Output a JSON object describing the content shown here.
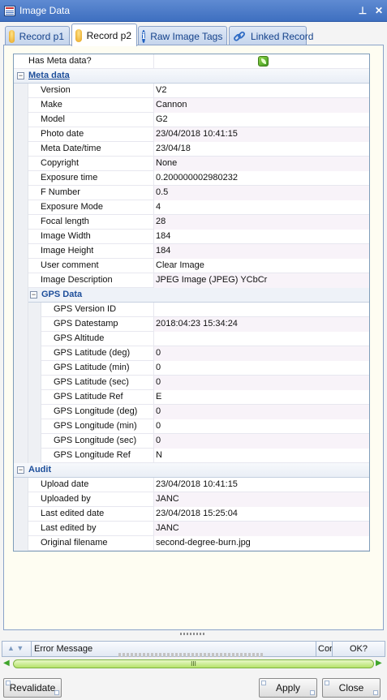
{
  "window": {
    "title": "Image Data"
  },
  "tabs": [
    {
      "label": "Record p1",
      "icon": "database-icon"
    },
    {
      "label": "Record p2",
      "icon": "database-icon"
    },
    {
      "label": "Raw Image Tags",
      "icon": "info-icon"
    },
    {
      "label": "Linked Record",
      "icon": "link-icon"
    }
  ],
  "top_row": {
    "label": "Has Meta data?",
    "value_icon": "leaf-icon"
  },
  "meta": {
    "title": "Meta data",
    "rows": [
      {
        "label": "Version",
        "value": "V2"
      },
      {
        "label": "Make",
        "value": "Cannon"
      },
      {
        "label": "Model",
        "value": "G2"
      },
      {
        "label": "Photo date",
        "value": "23/04/2018 10:41:15"
      },
      {
        "label": "Meta Date/time",
        "value": "23/04/18"
      },
      {
        "label": "Copyright",
        "value": "None"
      },
      {
        "label": "Exposure time",
        "value": "0.200000002980232"
      },
      {
        "label": "F Number",
        "value": "0.5"
      },
      {
        "label": "Exposure Mode",
        "value": "4"
      },
      {
        "label": "Focal length",
        "value": "28"
      },
      {
        "label": "Image Width",
        "value": "184"
      },
      {
        "label": "Image Height",
        "value": "184"
      },
      {
        "label": "User comment",
        "value": "Clear Image"
      },
      {
        "label": "Image Description",
        "value": "JPEG Image (JPEG) YCbCr"
      }
    ]
  },
  "gps": {
    "title": "GPS Data",
    "rows": [
      {
        "label": "GPS Version ID",
        "value": ""
      },
      {
        "label": "GPS Datestamp",
        "value": "2018:04:23 15:34:24"
      },
      {
        "label": "GPS Altitude",
        "value": ""
      },
      {
        "label": "GPS Latitude (deg)",
        "value": "0"
      },
      {
        "label": "GPS Latitude (min)",
        "value": "0"
      },
      {
        "label": "GPS Latitude (sec)",
        "value": "0"
      },
      {
        "label": "GPS Latitude Ref",
        "value": "E"
      },
      {
        "label": "GPS Longitude (deg)",
        "value": "0"
      },
      {
        "label": "GPS Longitude (min)",
        "value": "0"
      },
      {
        "label": "GPS Longitude (sec)",
        "value": "0"
      },
      {
        "label": "GPS Longitude Ref",
        "value": "N"
      }
    ]
  },
  "audit": {
    "title": "Audit",
    "rows": [
      {
        "label": "Upload date",
        "value": "23/04/2018 10:41:15"
      },
      {
        "label": "Uploaded by",
        "value": "JANC"
      },
      {
        "label": "Last edited date",
        "value": "23/04/2018 15:25:04"
      },
      {
        "label": "Last edited by",
        "value": "JANC"
      },
      {
        "label": "Original filename",
        "value": "second-degree-burn.jpg"
      }
    ]
  },
  "error_bar": {
    "col_message": "Error Message",
    "col_short": "Cor",
    "col_ok": "OK?"
  },
  "scroll": {
    "thumb_label": "III"
  },
  "buttons": {
    "revalidate": "Revalidate",
    "apply": "Apply",
    "close": "Close"
  },
  "titlebar_buttons": {
    "pin": "⊥",
    "close": "✕"
  }
}
